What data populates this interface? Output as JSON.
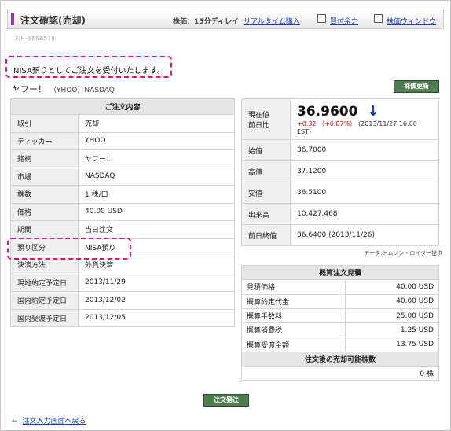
{
  "header": {
    "title": "注文確認(売却)",
    "delay": "株価：15分ディレイ",
    "realtime_link": "リアルタイム購入",
    "buying_power_link": "買付余力",
    "price_window_link": "株価ウィンドウ"
  },
  "account_id": "3JH-966B578",
  "notice": "NISA預りとしてご注文を受付いたします。",
  "stock": {
    "name": "ヤフー！",
    "code": "（YHOO）NASDAQ"
  },
  "update_button": "株価更新",
  "order": {
    "caption": "ご注文内容",
    "rows": [
      {
        "k": "取引",
        "v": "売却"
      },
      {
        "k": "ティッカー",
        "v": "YHOO"
      },
      {
        "k": "銘柄",
        "v": "ヤフー！"
      },
      {
        "k": "市場",
        "v": "NASDAQ"
      },
      {
        "k": "株数",
        "v": "1 株/口"
      },
      {
        "k": "価格",
        "v": "40.00 USD"
      },
      {
        "k": "期間",
        "v": "当日注文"
      },
      {
        "k": "預り区分",
        "v": "NISA預り"
      },
      {
        "k": "決済方法",
        "v": "外貨決済"
      },
      {
        "k": "現地約定予定日",
        "v": "2013/11/29"
      },
      {
        "k": "国内約定予定日",
        "v": "2013/12/02"
      },
      {
        "k": "国内受渡予定日",
        "v": "2013/12/05"
      }
    ]
  },
  "quote": {
    "label_current": "現在値",
    "label_prev": "前日比",
    "price": "36.9600",
    "change": "+0.32 （+0.87%）",
    "change_date": "(2013/11/27 16:00 EST)",
    "rows": [
      {
        "k": "始値",
        "v": "36.7000"
      },
      {
        "k": "高値",
        "v": "37.1200"
      },
      {
        "k": "安値",
        "v": "36.5100"
      },
      {
        "k": "出来高",
        "v": "10,427,468"
      },
      {
        "k": "前日終値",
        "v": "36.6400 (2013/11/26)"
      }
    ],
    "source": "データ:トムソン・ロイター提供"
  },
  "estimate": {
    "caption": "概算注文見積",
    "rows": [
      {
        "k": "見積価格",
        "v": "40.00 USD"
      },
      {
        "k": "概算約定代金",
        "v": "40.00 USD"
      },
      {
        "k": "概算手数料",
        "v": "25.00 USD"
      },
      {
        "k": "概算消費税",
        "v": "1.25 USD"
      },
      {
        "k": "概算受渡金額",
        "v": "13.75 USD"
      }
    ],
    "sell_caption": "注文後の売却可能株数",
    "sell_value": "0 株"
  },
  "submit_button": "注文発注",
  "back_link": "注文入力画面へ戻る",
  "back_arrow": "←",
  "price_arrow": "↓",
  "colors": {
    "accent": "#8a3fb3",
    "highlight": "#e0157b",
    "button": "#4f7d4f",
    "link": "#1a3fae",
    "up": "#d01010"
  }
}
